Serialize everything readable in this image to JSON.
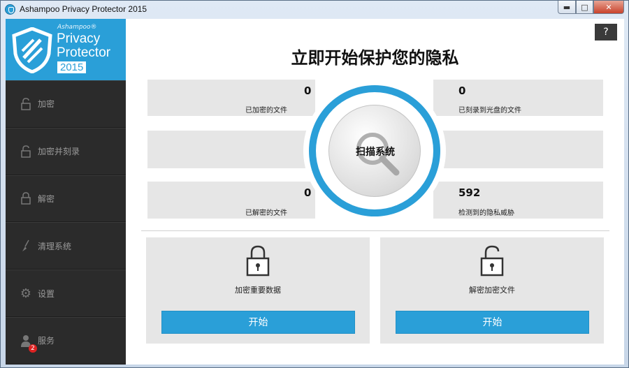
{
  "window": {
    "title": "Ashampoo Privacy Protector 2015"
  },
  "brand": {
    "small": "Ashampoo®",
    "line1": "Privacy",
    "line2": "Protector",
    "year": "2015"
  },
  "sidebar": {
    "items": [
      {
        "label": "加密",
        "icon": "unlock-icon"
      },
      {
        "label": "加密并刻录",
        "icon": "unlock-icon"
      },
      {
        "label": "解密",
        "icon": "lock-icon"
      },
      {
        "label": "清理系统",
        "icon": "broom-icon"
      },
      {
        "label": "设置",
        "icon": "gear-icon"
      },
      {
        "label": "服务",
        "icon": "support-person-icon",
        "badge": "2"
      }
    ]
  },
  "main": {
    "help": "?",
    "headline": "立即开始保护您的隐私",
    "stats": {
      "encrypted": {
        "value": "0",
        "label": "已加密的文件"
      },
      "burned": {
        "value": "0",
        "label": "已刻录到光盘的文件"
      },
      "decrypted": {
        "value": "0",
        "label": "已解密的文件"
      },
      "threats": {
        "value": "592",
        "label": "检测到的隐私威胁"
      }
    },
    "scan": {
      "label": "扫描系统"
    },
    "cards": [
      {
        "label": "加密重要数据",
        "button": "开始",
        "icon": "lock-icon"
      },
      {
        "label": "解密加密文件",
        "button": "开始",
        "icon": "unlock-icon"
      }
    ]
  },
  "colors": {
    "accent": "#2a9fd8",
    "sidebar": "#2b2b2b",
    "panel": "#e6e6e6"
  }
}
